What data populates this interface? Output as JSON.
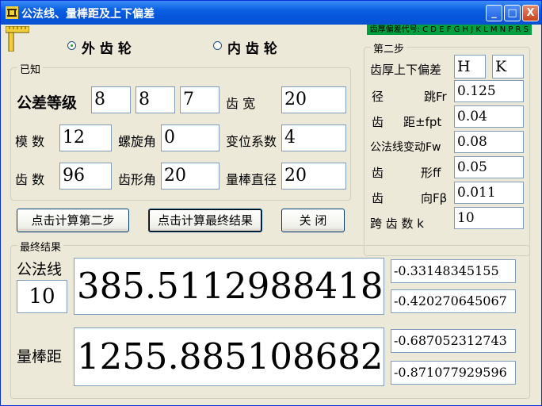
{
  "window": {
    "title": "公法线、量棒距及上下偏差",
    "min_label": "_",
    "max_label": "□",
    "close_label": "X"
  },
  "badge_text": "齿厚偏差代号: C D E F G H J K L M N P R S",
  "gear_type": {
    "external_label": "外  齿  轮",
    "internal_label": "内  齿  轮",
    "selected": "external"
  },
  "known": {
    "title": "已知",
    "tolerance_label": "公差等级",
    "tolerance_values": [
      "8",
      "8",
      "7"
    ],
    "face_width_label": "齿    宽",
    "face_width": "20",
    "module_label": "模   数",
    "module": "12",
    "helix_label": "螺旋角",
    "helix": "0",
    "shift_label": "变位系数",
    "shift": "4",
    "teeth_label": "齿   数",
    "teeth": "96",
    "pressure_label": "齿形角",
    "pressure": "20",
    "rod_label": "量棒直径",
    "rod": "20"
  },
  "step2": {
    "title": "第二步",
    "deviation_label": "齿厚上下偏差",
    "dev_upper": "H",
    "dev_lower": "K",
    "radial_label_a": "径",
    "radial_label_b": "跳Fr",
    "radial": "0.125",
    "pitch_label_a": "齿",
    "pitch_label_b": "距±fpt",
    "pitch": "0.04",
    "fw_label": "公法线变动Fw",
    "fw": "0.08",
    "profile_label_a": "齿",
    "profile_label_b": "形ff",
    "profile": "0.05",
    "helix_label_a": "齿",
    "helix_label_b": "向Fβ",
    "helix": "0.011",
    "span_label": "跨  齿  数 k",
    "span": "10"
  },
  "buttons": {
    "step2": "点击计算第二步",
    "final": "点击计算最终结果",
    "close": "关  闭"
  },
  "results": {
    "title": "最终结果",
    "wk_label": "公法线",
    "wk_count": "10",
    "wk_value": "385.5112988418",
    "wk_upper": "-0.33148345155",
    "wk_lower": "-0.420270645067",
    "m_label": "量棒距",
    "m_value": "1255.885108682",
    "m_upper": "-0.687052312743",
    "m_lower": "-0.871077929596"
  },
  "colors": {
    "titlebar": "#0A5FE2",
    "badge": "#00A040",
    "window_bg": "#ECE9D8"
  }
}
